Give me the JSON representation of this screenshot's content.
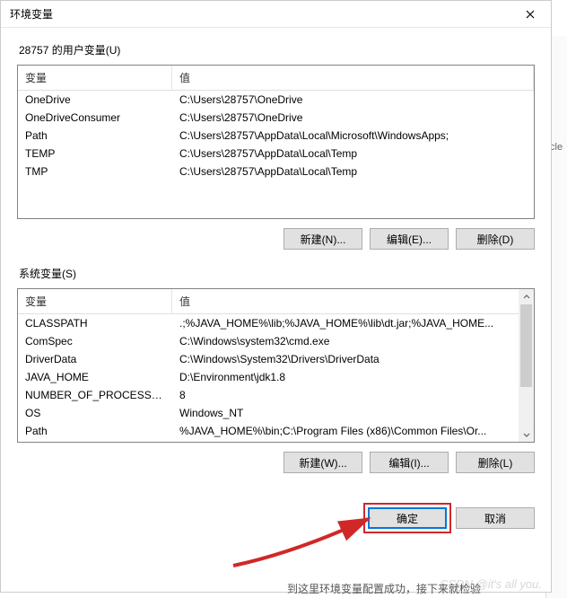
{
  "title": "环境变量",
  "user_section": {
    "label": "28757 的用户变量(U)",
    "headers": {
      "var": "变量",
      "val": "值"
    },
    "rows": [
      {
        "var": "OneDrive",
        "val": "C:\\Users\\28757\\OneDrive"
      },
      {
        "var": "OneDriveConsumer",
        "val": "C:\\Users\\28757\\OneDrive"
      },
      {
        "var": "Path",
        "val": "C:\\Users\\28757\\AppData\\Local\\Microsoft\\WindowsApps;"
      },
      {
        "var": "TEMP",
        "val": "C:\\Users\\28757\\AppData\\Local\\Temp"
      },
      {
        "var": "TMP",
        "val": "C:\\Users\\28757\\AppData\\Local\\Temp"
      }
    ],
    "buttons": {
      "new": "新建(N)...",
      "edit": "编辑(E)...",
      "delete": "删除(D)"
    }
  },
  "system_section": {
    "label": "系统变量(S)",
    "headers": {
      "var": "变量",
      "val": "值"
    },
    "rows": [
      {
        "var": "CLASSPATH",
        "val": ".;%JAVA_HOME%\\lib;%JAVA_HOME%\\lib\\dt.jar;%JAVA_HOME..."
      },
      {
        "var": "ComSpec",
        "val": "C:\\Windows\\system32\\cmd.exe"
      },
      {
        "var": "DriverData",
        "val": "C:\\Windows\\System32\\Drivers\\DriverData"
      },
      {
        "var": "JAVA_HOME",
        "val": "D:\\Environment\\jdk1.8"
      },
      {
        "var": "NUMBER_OF_PROCESSORS",
        "val": "8"
      },
      {
        "var": "OS",
        "val": "Windows_NT"
      },
      {
        "var": "Path",
        "val": "%JAVA_HOME%\\bin;C:\\Program Files (x86)\\Common Files\\Or..."
      }
    ],
    "buttons": {
      "new": "新建(W)...",
      "edit": "编辑(I)...",
      "delete": "删除(L)"
    }
  },
  "dialog_buttons": {
    "ok": "确定",
    "cancel": "取消"
  },
  "footer_text": "到这里环境变量配置成功，接下来就检验",
  "watermark": "CSDN @it's all you.",
  "outer_fragment": "cle"
}
